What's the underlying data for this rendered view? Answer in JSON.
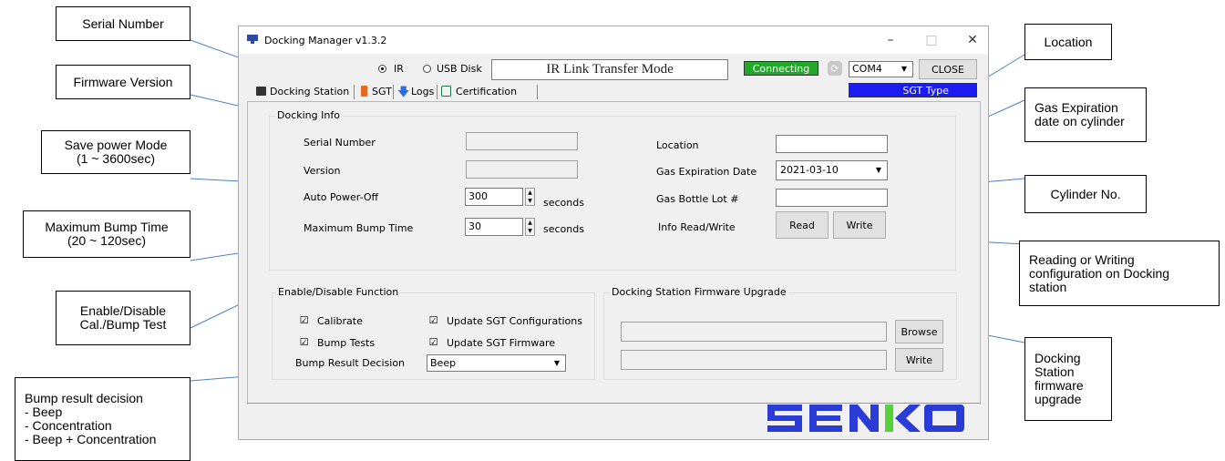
{
  "callouts": {
    "serial_number": "Serial Number",
    "firmware_version": "Firmware Version",
    "save_power": "Save power Mode\n(1 ~ 3600sec)",
    "max_bump": "Maximum Bump Time\n(20 ~ 120sec)",
    "enable_disable": "Enable/Disable\nCal./Bump Test",
    "bump_result": "Bump result decision\n- Beep\n- Concentration\n- Beep + Concentration",
    "location": "Location",
    "gas_expiration": "Gas Expiration\ndate on cylinder",
    "cylinder_no": "Cylinder No.",
    "read_write": "Reading or Writing\nconfiguration on Docking\nstation",
    "fw_upgrade": "Docking\nStation\nfirmware\nupgrade"
  },
  "window": {
    "title": "Docking Manager v1.3.2",
    "minimize": "–",
    "maximize": "□",
    "close": "✕"
  },
  "toolbar": {
    "radio_ir": "IR",
    "radio_usb": "USB Disk",
    "mode_text": "IR Link Transfer Mode",
    "status": "Connecting",
    "com_port": "COM4",
    "close_button": "CLOSE",
    "sgt_type": "SGT Type"
  },
  "tabs": [
    "Docking Station",
    "SGT",
    "Logs",
    "Certification"
  ],
  "docking_info": {
    "group_label": "Docking Info",
    "serial_number_label": "Serial Number",
    "version_label": "Version",
    "auto_power_off_label": "Auto Power-Off",
    "auto_power_off_value": "300",
    "max_bump_label": "Maximum Bump Time",
    "max_bump_value": "30",
    "seconds": "seconds",
    "location_label": "Location",
    "gas_exp_label": "Gas Expiration Date",
    "gas_exp_value": "2021-03-10",
    "gas_lot_label": "Gas Bottle Lot #",
    "info_rw_label": "Info Read/Write",
    "read_button": "Read",
    "write_button": "Write"
  },
  "functions": {
    "group_label": "Enable/Disable Function",
    "calibrate": "Calibrate",
    "bump_tests": "Bump Tests",
    "update_config": "Update SGT Configurations",
    "update_fw": "Update SGT Firmware",
    "bump_result_label": "Bump Result Decision",
    "bump_result_value": "Beep"
  },
  "firmware_upgrade": {
    "group_label": "Docking Station Firmware Upgrade",
    "browse_button": "Browse",
    "write_button": "Write"
  },
  "brand": {
    "logo_text": "SENKO",
    "logo_color": "#2a3bd6",
    "accent_color": "#57d13a"
  },
  "colors": {
    "status_green": "#22a82a",
    "sgt_blue": "#1c1cf0"
  }
}
